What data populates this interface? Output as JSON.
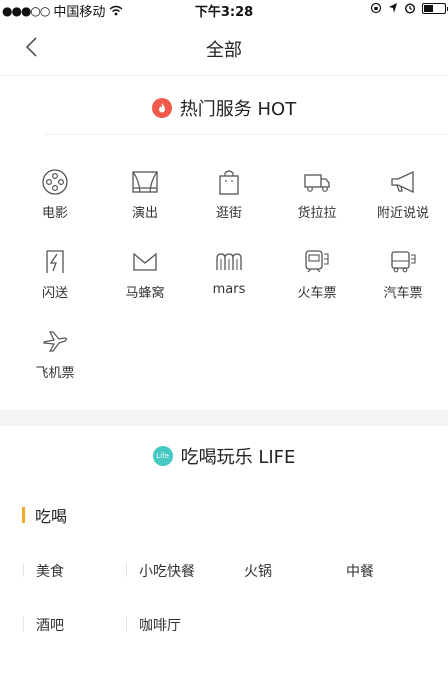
{
  "status_bar": {
    "signal": "●●●○○",
    "carrier": "中国移动",
    "time": "下午3:28"
  },
  "nav": {
    "title": "全部"
  },
  "hot_section": {
    "title": "热门服务 HOT",
    "items": [
      {
        "label": "电影",
        "icon": "film-reel-icon"
      },
      {
        "label": "演出",
        "icon": "stage-icon"
      },
      {
        "label": "逛街",
        "icon": "shopping-bag-icon"
      },
      {
        "label": "货拉拉",
        "icon": "truck-icon"
      },
      {
        "label": "附近说说",
        "icon": "megaphone-icon"
      },
      {
        "label": "闪送",
        "icon": "lightning-icon"
      },
      {
        "label": "马蜂窝",
        "icon": "mafengwo-icon"
      },
      {
        "label": "mars",
        "icon": "mars-icon"
      },
      {
        "label": "火车票",
        "icon": "train-icon"
      },
      {
        "label": "汽车票",
        "icon": "bus-icon"
      },
      {
        "label": "飞机票",
        "icon": "airplane-icon"
      }
    ]
  },
  "life_section": {
    "badge": "Life",
    "title": "吃喝玩乐 LIFE",
    "category": "吃喝",
    "tags_row1": [
      "美食",
      "小吃快餐",
      "火锅",
      "中餐"
    ],
    "tags_row2": [
      "酒吧",
      "咖啡厅"
    ]
  },
  "colors": {
    "hot_badge": "#f15a4a",
    "life_badge": "#45c7c2",
    "category_bar": "#f5a623"
  }
}
